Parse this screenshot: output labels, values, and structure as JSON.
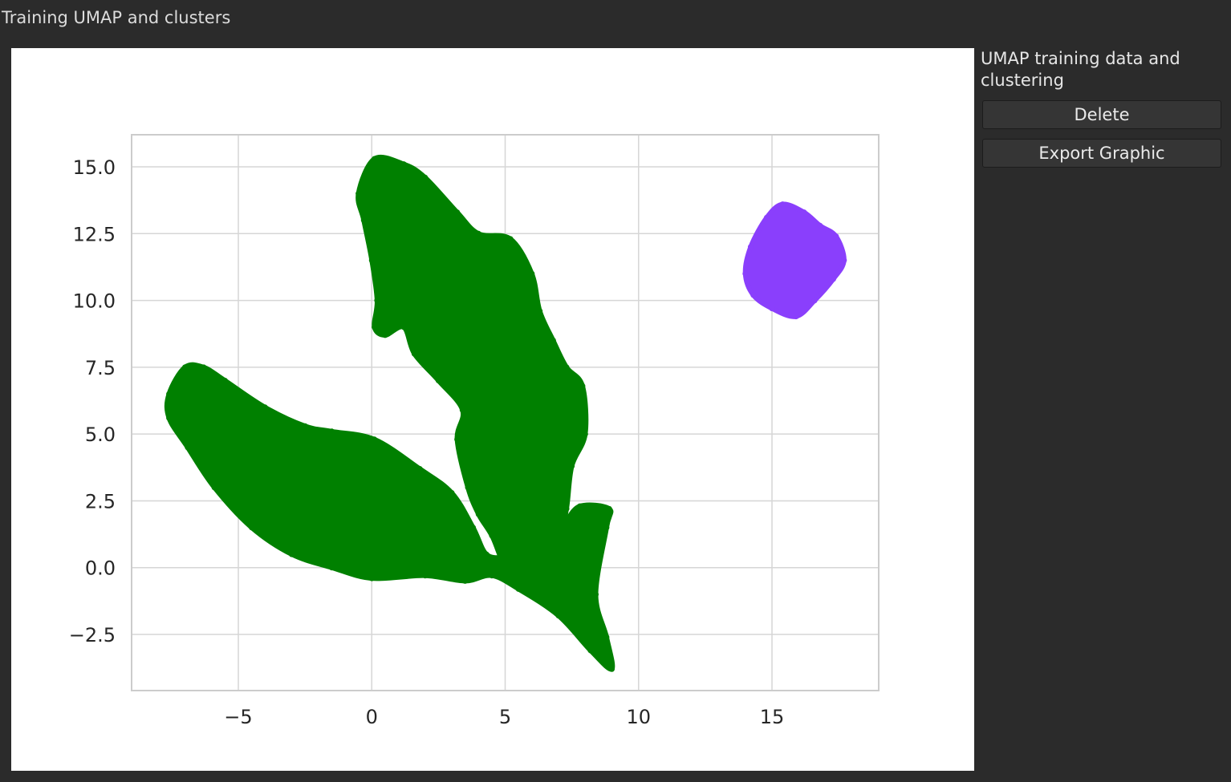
{
  "window": {
    "title": "Training UMAP and clusters"
  },
  "sidebar": {
    "title": "UMAP training data and clustering",
    "buttons": {
      "delete": "Delete",
      "export": "Export Graphic"
    }
  },
  "colors": {
    "cluster_0": "#008000",
    "cluster_1": "#8a3ffc",
    "grid": "#d6d6d6",
    "background": "#2b2b2b"
  },
  "chart_data": {
    "type": "scatter",
    "title": "",
    "xlabel": "",
    "ylabel": "",
    "xlim": [
      -9,
      19
    ],
    "ylim": [
      -4.6,
      16.2
    ],
    "xticks": [
      -5,
      0,
      5,
      10,
      15
    ],
    "yticks": [
      -2.5,
      0.0,
      2.5,
      5.0,
      7.5,
      10.0,
      12.5,
      15.0
    ],
    "xtick_labels": [
      "−5",
      "0",
      "5",
      "10",
      "15"
    ],
    "ytick_labels": [
      "−2.5",
      "0.0",
      "2.5",
      "5.0",
      "7.5",
      "10.0",
      "12.5",
      "15.0"
    ],
    "grid": true,
    "series": [
      {
        "color": "#008000",
        "points": [
          [
            -7.0,
            7.5
          ],
          [
            -7.6,
            6.5
          ],
          [
            -7.6,
            5.6
          ],
          [
            -6.9,
            4.5
          ],
          [
            -5.9,
            3.0
          ],
          [
            -4.5,
            1.5
          ],
          [
            -3.0,
            0.5
          ],
          [
            -1.5,
            0.0
          ],
          [
            0.0,
            -0.4
          ],
          [
            2.0,
            -0.3
          ],
          [
            3.5,
            -0.5
          ],
          [
            4.5,
            -0.3
          ],
          [
            5.5,
            -0.8
          ],
          [
            7.0,
            -1.8
          ],
          [
            8.2,
            -3.1
          ],
          [
            9.0,
            -3.8
          ],
          [
            8.8,
            -2.6
          ],
          [
            8.4,
            -1.0
          ],
          [
            8.8,
            1.5
          ],
          [
            8.9,
            2.2
          ],
          [
            7.8,
            2.3
          ],
          [
            7.2,
            1.6
          ],
          [
            6.6,
            0.8
          ],
          [
            6.1,
            1.0
          ],
          [
            5.6,
            0.6
          ],
          [
            5.0,
            0.4
          ],
          [
            4.3,
            0.5
          ],
          [
            3.8,
            1.5
          ],
          [
            3.0,
            2.8
          ],
          [
            1.8,
            3.7
          ],
          [
            0.1,
            4.8
          ],
          [
            -1.5,
            5.1
          ],
          [
            -2.5,
            5.3
          ],
          [
            -4.0,
            6.0
          ],
          [
            -5.5,
            7.0
          ],
          [
            -6.3,
            7.5
          ]
        ]
      },
      {
        "color": "#008000",
        "points": [
          [
            0.1,
            15.3
          ],
          [
            -0.5,
            14.0
          ],
          [
            -0.3,
            13.0
          ],
          [
            0.0,
            11.5
          ],
          [
            0.2,
            10.0
          ],
          [
            0.1,
            9.0
          ],
          [
            0.5,
            8.7
          ],
          [
            1.2,
            9.0
          ],
          [
            1.6,
            8.0
          ],
          [
            2.5,
            7.0
          ],
          [
            3.4,
            5.9
          ],
          [
            3.2,
            4.8
          ],
          [
            3.6,
            3.0
          ],
          [
            4.0,
            2.0
          ],
          [
            4.5,
            1.2
          ],
          [
            5.2,
            -0.2
          ],
          [
            6.3,
            0.2
          ],
          [
            7.0,
            1.0
          ],
          [
            7.3,
            2.2
          ],
          [
            7.5,
            3.8
          ],
          [
            8.0,
            5.0
          ],
          [
            7.9,
            6.8
          ],
          [
            7.3,
            7.5
          ],
          [
            6.8,
            8.5
          ],
          [
            6.3,
            9.6
          ],
          [
            6.0,
            11.0
          ],
          [
            5.2,
            12.3
          ],
          [
            4.0,
            12.5
          ],
          [
            3.2,
            13.3
          ],
          [
            2.0,
            14.6
          ],
          [
            1.2,
            15.1
          ]
        ]
      },
      {
        "color": "#8a3ffc",
        "points": [
          [
            15.4,
            13.6
          ],
          [
            14.8,
            13.1
          ],
          [
            14.2,
            12.0
          ],
          [
            14.0,
            11.0
          ],
          [
            14.3,
            10.2
          ],
          [
            15.0,
            9.7
          ],
          [
            15.9,
            9.4
          ],
          [
            16.6,
            10.0
          ],
          [
            17.3,
            10.8
          ],
          [
            17.7,
            11.5
          ],
          [
            17.4,
            12.4
          ],
          [
            16.8,
            12.8
          ],
          [
            16.2,
            13.3
          ]
        ]
      }
    ]
  }
}
